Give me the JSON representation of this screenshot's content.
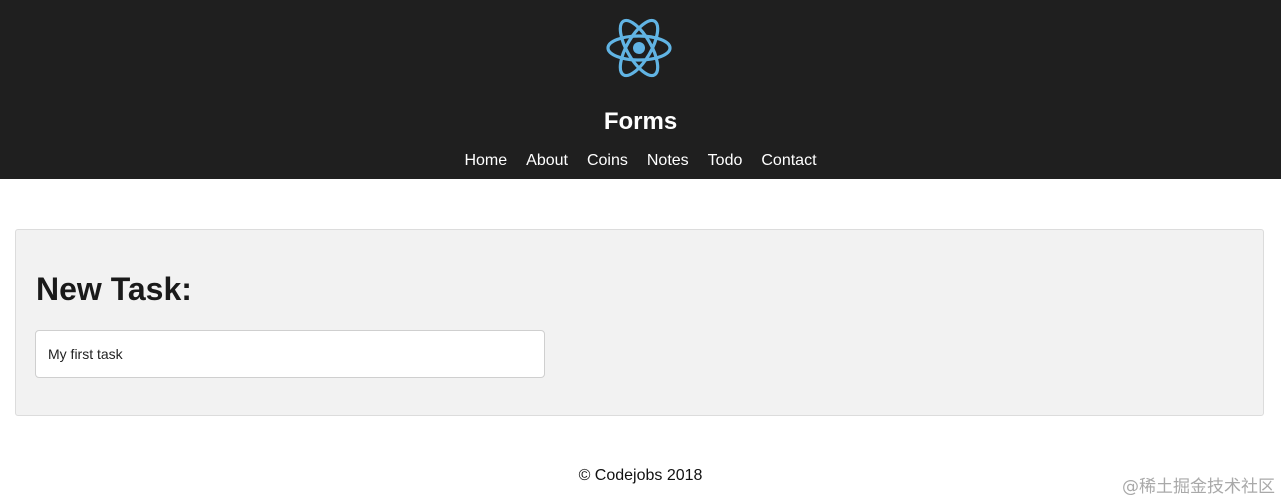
{
  "colors": {
    "header_bg": "#1f1f1f",
    "logo_accent": "#61b4e4",
    "panel_bg": "#f2f2f2"
  },
  "header": {
    "logo_icon": "react-atom-icon",
    "title": "Forms",
    "nav": [
      {
        "label": "Home"
      },
      {
        "label": "About"
      },
      {
        "label": "Coins"
      },
      {
        "label": "Notes"
      },
      {
        "label": "Todo"
      },
      {
        "label": "Contact"
      }
    ]
  },
  "main": {
    "heading": "New Task:",
    "task_input": {
      "value": "My first task",
      "placeholder": ""
    }
  },
  "footer": {
    "copyright": "© Codejobs 2018"
  },
  "watermark": "@稀土掘金技术社区"
}
